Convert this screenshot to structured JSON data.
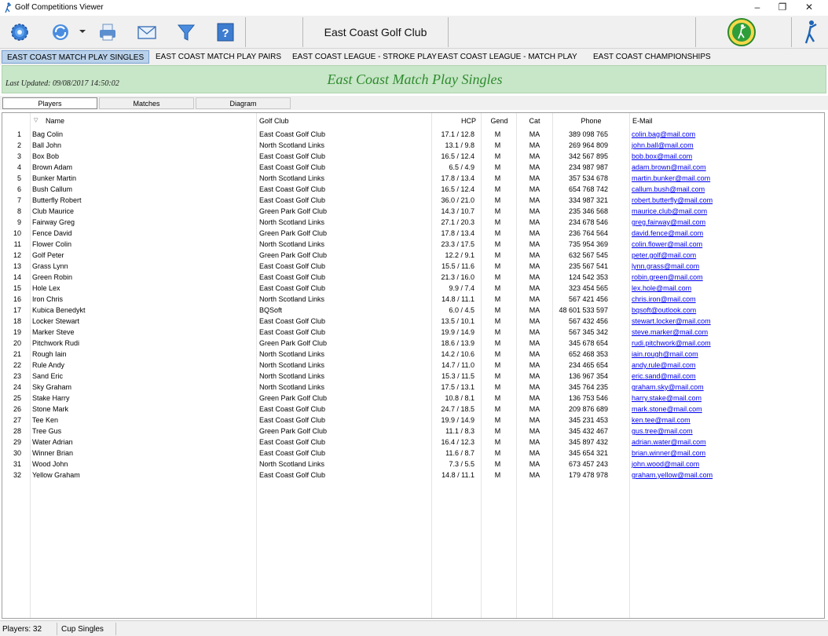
{
  "window": {
    "title": "Golf Competitions Viewer"
  },
  "toolbar": {
    "club_name": "East Coast Golf Club",
    "buttons": [
      "settings-icon",
      "refresh-icon",
      "print-icon",
      "email-icon",
      "filter-icon",
      "help-icon"
    ]
  },
  "competition_tabs": [
    "EAST COAST MATCH PLAY SINGLES",
    "EAST COAST MATCH PLAY PAIRS",
    "EAST COAST LEAGUE - STROKE PLAY",
    "EAST COAST LEAGUE - MATCH PLAY",
    "EAST COAST CHAMPIONSHIPS"
  ],
  "active_tab": "EAST COAST MATCH PLAY SINGLES",
  "banner": {
    "last_updated": "Last Updated: 09/08/2017 14:50:02",
    "title": "East Coast Match Play Singles"
  },
  "sub_tabs": [
    "Players",
    "Matches",
    "Diagram"
  ],
  "columns": [
    "Name",
    "Golf Club",
    "HCP",
    "Gend",
    "Cat",
    "Phone",
    "E-Mail"
  ],
  "players": [
    [
      "1",
      "Bag Colin",
      "East Coast Golf Club",
      "17.1 / 12.8",
      "M",
      "MA",
      "389 098 765",
      "colin.bag@mail.com"
    ],
    [
      "2",
      "Ball John",
      "North Scotland Links",
      "13.1 / 9.8",
      "M",
      "MA",
      "269 964 809",
      "john.ball@mail.com"
    ],
    [
      "3",
      "Box Bob",
      "East Coast Golf Club",
      "16.5 / 12.4",
      "M",
      "MA",
      "342 567 895",
      "bob.box@mail.com"
    ],
    [
      "4",
      "Brown Adam",
      "East Coast Golf Club",
      "6.5 / 4.9",
      "M",
      "MA",
      "234 987 987",
      "adam.brown@mail.com"
    ],
    [
      "5",
      "Bunker Martin",
      "North Scotland Links",
      "17.8 / 13.4",
      "M",
      "MA",
      "357 534 678",
      "martin.bunker@mail.com"
    ],
    [
      "6",
      "Bush Callum",
      "East Coast Golf Club",
      "16.5 / 12.4",
      "M",
      "MA",
      "654 768 742",
      "callum.bush@mail.com"
    ],
    [
      "7",
      "Butterfly Robert",
      "East Coast Golf Club",
      "36.0 / 21.0",
      "M",
      "MA",
      "334 987 321",
      "robert.butterfly@mail.com"
    ],
    [
      "8",
      "Club Maurice",
      "Green Park Golf Club",
      "14.3 / 10.7",
      "M",
      "MA",
      "235 346 568",
      "maurice.club@mail.com"
    ],
    [
      "9",
      "Fairway Greg",
      "North Scotland Links",
      "27.1 / 20.3",
      "M",
      "MA",
      "234 678 546",
      "greg.fairway@mail.com"
    ],
    [
      "10",
      "Fence David",
      "Green Park Golf Club",
      "17.8 / 13.4",
      "M",
      "MA",
      "236 764 564",
      "david.fence@mail.com"
    ],
    [
      "11",
      "Flower Colin",
      "North Scotland Links",
      "23.3 / 17.5",
      "M",
      "MA",
      "735 954 369",
      "colin.flower@mail.com"
    ],
    [
      "12",
      "Golf Peter",
      "Green Park Golf Club",
      "12.2 / 9.1",
      "M",
      "MA",
      "632 567 545",
      "peter.golf@mail.com"
    ],
    [
      "13",
      "Grass Lynn",
      "East Coast Golf Club",
      "15.5 / 11.6",
      "M",
      "MA",
      "235 567 541",
      "lynn.grass@mail.com"
    ],
    [
      "14",
      "Green Robin",
      "East Coast Golf Club",
      "21.3 / 16.0",
      "M",
      "MA",
      "124 542 353",
      "robin.green@mail.com"
    ],
    [
      "15",
      "Hole Lex",
      "East Coast Golf Club",
      "9.9 / 7.4",
      "M",
      "MA",
      "323 454 565",
      "lex.hole@mail.com"
    ],
    [
      "16",
      "Iron Chris",
      "North Scotland Links",
      "14.8 / 11.1",
      "M",
      "MA",
      "567 421 456",
      "chris.iron@mail.com"
    ],
    [
      "17",
      "Kubica Benedykt",
      "BQSoft",
      "6.0 / 4.5",
      "M",
      "MA",
      "48 601 533 597",
      "bqsoft@outlook.com"
    ],
    [
      "18",
      "Locker Stewart",
      "East Coast Golf Club",
      "13.5 / 10.1",
      "M",
      "MA",
      "567 432 456",
      "stewart.locker@mail.com"
    ],
    [
      "19",
      "Marker Steve",
      "East Coast Golf Club",
      "19.9 / 14.9",
      "M",
      "MA",
      "567 345 342",
      "steve.marker@mail.com"
    ],
    [
      "20",
      "Pitchwork Rudi",
      "Green Park Golf Club",
      "18.6 / 13.9",
      "M",
      "MA",
      "345 678 654",
      "rudi.pitchwork@mail.com"
    ],
    [
      "21",
      "Rough Iain",
      "North Scotland Links",
      "14.2 / 10.6",
      "M",
      "MA",
      "652 468 353",
      "iain.rough@mail.com"
    ],
    [
      "22",
      "Rule Andy",
      "North Scotland Links",
      "14.7 / 11.0",
      "M",
      "MA",
      "234 465 654",
      "andy.rule@mail.com"
    ],
    [
      "23",
      "Sand Eric",
      "North Scotland Links",
      "15.3 / 11.5",
      "M",
      "MA",
      "136 967 354",
      "eric.sand@mail.com"
    ],
    [
      "24",
      "Sky Graham",
      "North Scotland Links",
      "17.5 / 13.1",
      "M",
      "MA",
      "345 764 235",
      "graham.sky@mail.com"
    ],
    [
      "25",
      "Stake Harry",
      "Green Park Golf Club",
      "10.8 / 8.1",
      "M",
      "MA",
      "136 753 546",
      "harry.stake@mail.com"
    ],
    [
      "26",
      "Stone Mark",
      "East Coast Golf Club",
      "24.7 / 18.5",
      "M",
      "MA",
      "209 876 689",
      "mark.stone@mail.com"
    ],
    [
      "27",
      "Tee Ken",
      "East Coast Golf Club",
      "19.9 / 14.9",
      "M",
      "MA",
      "345 231 453",
      "ken.tee@mail.com"
    ],
    [
      "28",
      "Tree Gus",
      "Green Park Golf Club",
      "11.1 / 8.3",
      "M",
      "MA",
      "345 432 467",
      "gus.tree@mail.com"
    ],
    [
      "29",
      "Water Adrian",
      "East Coast Golf Club",
      "16.4 / 12.3",
      "M",
      "MA",
      "345 897 432",
      "adrian.water@mail.com"
    ],
    [
      "30",
      "Winner Brian",
      "East Coast Golf Club",
      "11.6 / 8.7",
      "M",
      "MA",
      "345 654 321",
      "brian.winner@mail.com"
    ],
    [
      "31",
      "Wood John",
      "North Scotland Links",
      "7.3 / 5.5",
      "M",
      "MA",
      "673 457 243",
      "john.wood@mail.com"
    ],
    [
      "32",
      "Yellow Graham",
      "East Coast Golf Club",
      "14.8 / 11.1",
      "M",
      "MA",
      "179 478 978",
      "graham.yellow@mail.com"
    ]
  ],
  "status": {
    "players": "Players: 32",
    "mode": "Cup Singles"
  }
}
